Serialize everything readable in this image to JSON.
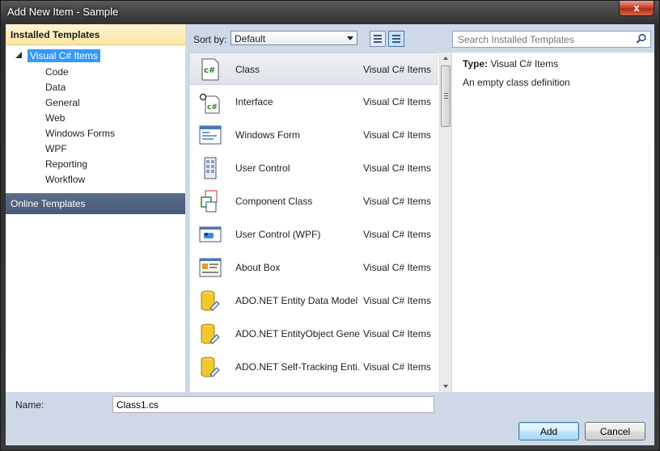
{
  "window": {
    "title": "Add New Item - Sample",
    "close_symbol": "x"
  },
  "left_panel": {
    "installed_header": "Installed Templates",
    "root": "Visual C# Items",
    "children": [
      "Code",
      "Data",
      "General",
      "Web",
      "Windows Forms",
      "WPF",
      "Reporting",
      "Workflow"
    ],
    "online_header": "Online Templates"
  },
  "toolbar": {
    "sort_label": "Sort by:",
    "sort_value": "Default",
    "search_placeholder": "Search Installed Templates"
  },
  "templates": [
    {
      "name": "Class",
      "category": "Visual C# Items",
      "icon": "class-icon"
    },
    {
      "name": "Interface",
      "category": "Visual C# Items",
      "icon": "interface-icon"
    },
    {
      "name": "Windows Form",
      "category": "Visual C# Items",
      "icon": "windows-form-icon"
    },
    {
      "name": "User Control",
      "category": "Visual C# Items",
      "icon": "user-control-icon"
    },
    {
      "name": "Component Class",
      "category": "Visual C# Items",
      "icon": "component-class-icon"
    },
    {
      "name": "User Control (WPF)",
      "category": "Visual C# Items",
      "icon": "wpf-user-control-icon"
    },
    {
      "name": "About Box",
      "category": "Visual C# Items",
      "icon": "about-box-icon"
    },
    {
      "name": "ADO.NET Entity Data Model",
      "category": "Visual C# Items",
      "icon": "database-icon"
    },
    {
      "name": "ADO.NET EntityObject Gene...",
      "category": "Visual C# Items",
      "icon": "database-icon"
    },
    {
      "name": "ADO.NET Self-Tracking Enti...",
      "category": "Visual C# Items",
      "icon": "database-icon"
    }
  ],
  "details": {
    "type_label": "Type:",
    "type_value": "Visual C# Items",
    "description": "An empty class definition"
  },
  "footer": {
    "name_label": "Name:",
    "name_value": "Class1.cs",
    "add_label": "Add",
    "cancel_label": "Cancel"
  },
  "colors": {
    "selection": "#3399ff",
    "online_header": "#4f5f7e",
    "installed_header": "#fde6a5",
    "dialog_bg": "#cfd8e6"
  }
}
